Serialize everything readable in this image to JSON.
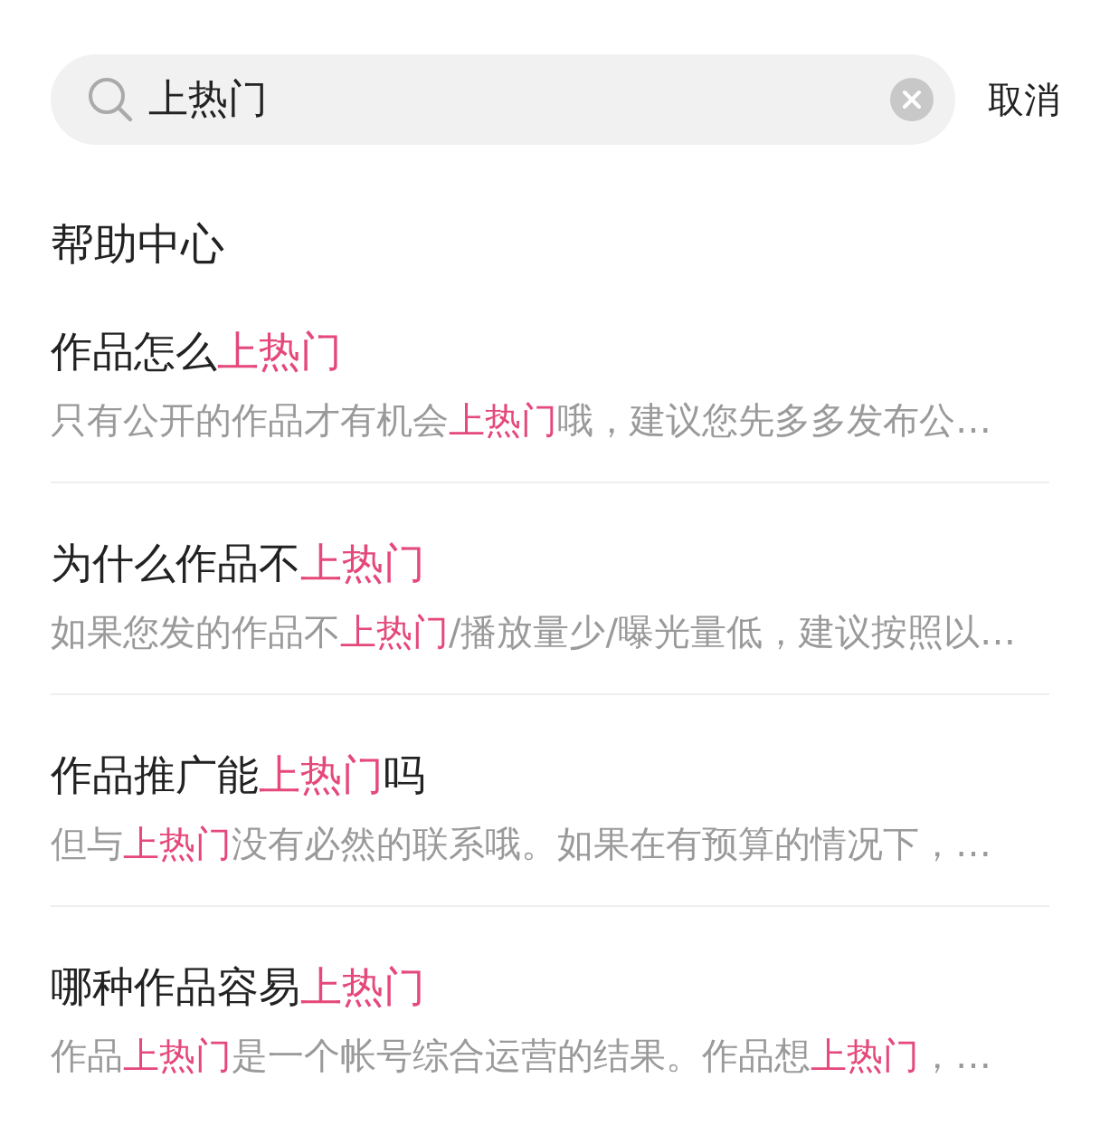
{
  "search": {
    "value": "上热门",
    "cancel": "取消"
  },
  "section_title": "帮助中心",
  "results": [
    {
      "title": [
        {
          "text": "作品怎么",
          "highlight": false
        },
        {
          "text": "上热门",
          "highlight": true
        }
      ],
      "snippet": [
        {
          "text": "只有公开的作品才有机会",
          "highlight": false
        },
        {
          "text": "上热门",
          "highlight": true
        },
        {
          "text": "哦，建议您先多多发布公…",
          "highlight": false
        }
      ]
    },
    {
      "title": [
        {
          "text": "为什么作品不",
          "highlight": false
        },
        {
          "text": "上热门",
          "highlight": true
        }
      ],
      "snippet": [
        {
          "text": "如果您发的作品不",
          "highlight": false
        },
        {
          "text": "上热门",
          "highlight": true
        },
        {
          "text": "/播放量少/曝光量低，建议按照以…",
          "highlight": false
        }
      ]
    },
    {
      "title": [
        {
          "text": "作品推广能",
          "highlight": false
        },
        {
          "text": "上热门",
          "highlight": true
        },
        {
          "text": "吗",
          "highlight": false
        }
      ],
      "snippet": [
        {
          "text": "但与",
          "highlight": false
        },
        {
          "text": "上热门",
          "highlight": true
        },
        {
          "text": "没有必然的联系哦。如果在有预算的情况下，…",
          "highlight": false
        }
      ]
    },
    {
      "title": [
        {
          "text": "哪种作品容易",
          "highlight": false
        },
        {
          "text": "上热门",
          "highlight": true
        }
      ],
      "snippet": [
        {
          "text": "作品",
          "highlight": false
        },
        {
          "text": "上热门",
          "highlight": true
        },
        {
          "text": "是一个帐号综合运营的结果。作品想",
          "highlight": false
        },
        {
          "text": "上热门",
          "highlight": true
        },
        {
          "text": "，…",
          "highlight": false
        }
      ]
    }
  ]
}
